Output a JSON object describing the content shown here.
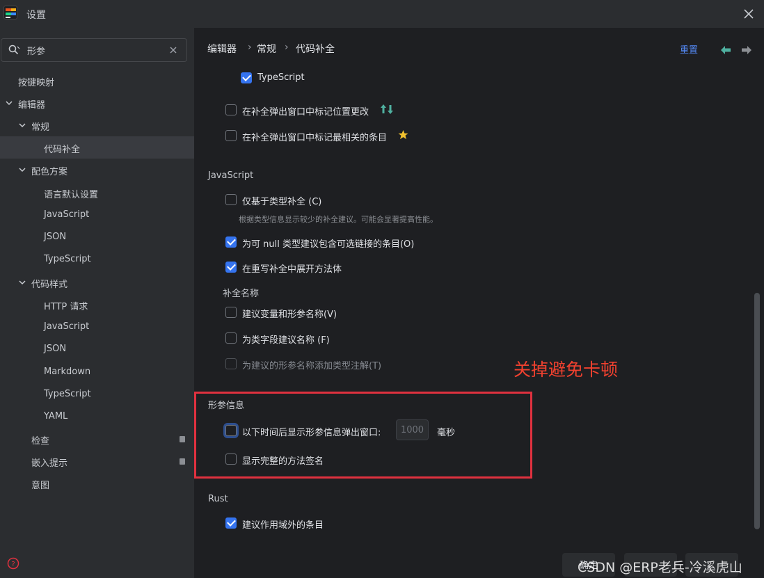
{
  "window": {
    "title": "设置"
  },
  "search": {
    "value": "形参"
  },
  "sidebar": {
    "items": [
      {
        "label": "按键映射"
      },
      {
        "label": "编辑器"
      },
      {
        "label": "常规"
      },
      {
        "label": "代码补全"
      },
      {
        "label": "配色方案"
      },
      {
        "label": "语言默认设置"
      },
      {
        "label": "JavaScript"
      },
      {
        "label": "JSON"
      },
      {
        "label": "TypeScript"
      },
      {
        "label": "代码样式"
      },
      {
        "label": "HTTP 请求"
      },
      {
        "label": "JavaScript"
      },
      {
        "label": "JSON"
      },
      {
        "label": "Markdown"
      },
      {
        "label": "TypeScript"
      },
      {
        "label": "YAML"
      },
      {
        "label": "检查"
      },
      {
        "label": "嵌入提示"
      },
      {
        "label": "意图"
      }
    ]
  },
  "breadcrumb": {
    "items": [
      "编辑器",
      "常规",
      "代码补全"
    ],
    "sep": "›"
  },
  "header": {
    "reset_label": "重置"
  },
  "options": {
    "ts_typescript": {
      "label": "TypeScript",
      "checked": true
    },
    "mark_position_change": {
      "label": "在补全弹出窗口中标记位置更改",
      "checked": false
    },
    "mark_most_relevant": {
      "label": "在补全弹出窗口中标记最相关的条目",
      "checked": false
    },
    "js_section": "JavaScript",
    "type_based_only": {
      "label": "仅基于类型补全 (C)",
      "hint": "根据类型信息显示较少的补全建议。可能会显著提高性能。",
      "checked": false
    },
    "nullable_chains": {
      "label": "为可 null 类型建议包含可选链接的条目(O)",
      "checked": true
    },
    "expand_method_body": {
      "label": "在重写补全中展开方法体",
      "checked": true
    },
    "completion_names_section": "补全名称",
    "suggest_var_names": {
      "label": "建议变量和形参名称(V)",
      "checked": false
    },
    "suggest_field_names": {
      "label": "为类字段建议名称 (F)",
      "checked": false
    },
    "add_type_annotations": {
      "label": "为建议的形参名称添加类型注解(T)",
      "checked": false
    },
    "param_info_section": "形参信息",
    "show_param_popup": {
      "label": "以下时间后显示形参信息弹出窗口:",
      "value": "1000",
      "unit": "毫秒",
      "checked": false
    },
    "show_full_signature": {
      "label": "显示完整的方法签名",
      "checked": false
    },
    "rust_section": "Rust",
    "rust_out_of_scope": {
      "label": "建议作用域外的条目",
      "checked": true
    }
  },
  "annotation": {
    "text": "关掉避免卡顿"
  },
  "footer": {
    "ok_label": "确定"
  },
  "watermark": {
    "credit": "CSDN @ERP老兵-冷溪虎山",
    "text": "ERP老兵-冷溪虎山"
  },
  "colors": {
    "accent": "#3574f0",
    "annotation": "#e0313f"
  },
  "icons": [
    "app-logo-icon",
    "close-icon",
    "search-icon",
    "clear-icon",
    "chevron-down-icon",
    "pin-icon",
    "arrows-icon",
    "star-icon",
    "help-icon",
    "back-arrow-icon",
    "forward-arrow-icon"
  ]
}
